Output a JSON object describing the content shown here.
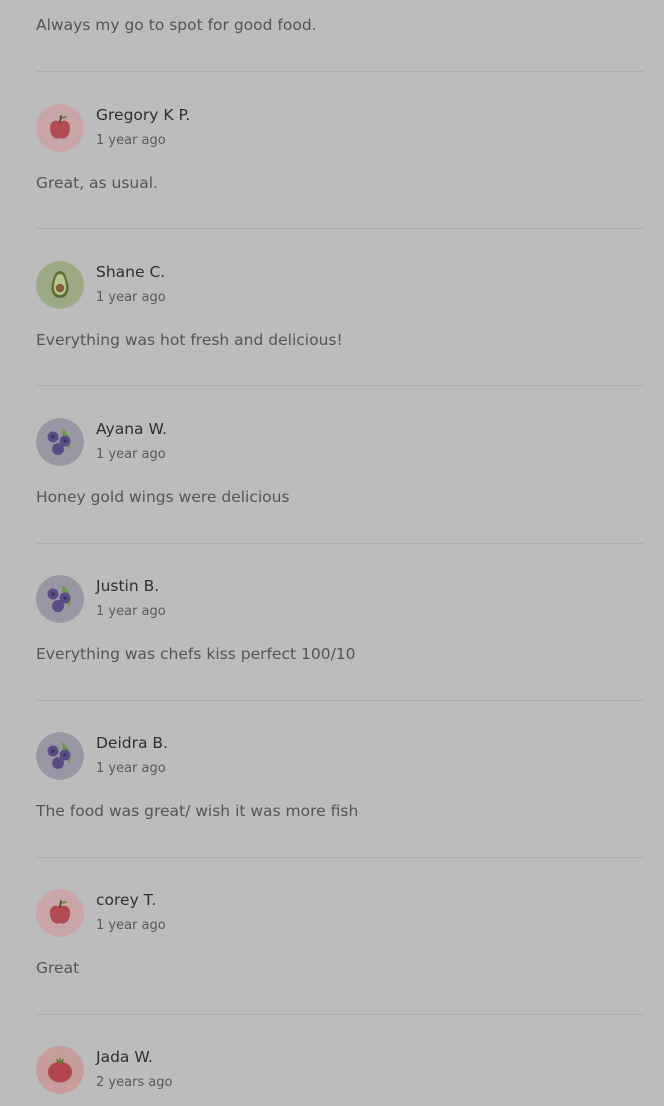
{
  "top_review_text": "Always my go to spot for good food.",
  "reviews": [
    {
      "name": "Gregory K P.",
      "time": "1 year ago",
      "text": "Great, as usual.",
      "avatar": "apple-icon"
    },
    {
      "name": "Shane C.",
      "time": "1 year ago",
      "text": "Everything was hot fresh and delicious!",
      "avatar": "avocado-icon"
    },
    {
      "name": "Ayana W.",
      "time": "1 year ago",
      "text": "Honey gold wings were delicious",
      "avatar": "blueberries-icon"
    },
    {
      "name": "Justin B.",
      "time": "1 year ago",
      "text": "Everything was chefs kiss perfect 100/10",
      "avatar": "blueberries-icon"
    },
    {
      "name": "Deidra B.",
      "time": "1 year ago",
      "text": "The food was great/ wish it was more fish",
      "avatar": "blueberries-icon"
    },
    {
      "name": "corey T.",
      "time": "1 year ago",
      "text": "Great",
      "avatar": "apple-icon"
    },
    {
      "name": "Jada W.",
      "time": "2 years ago",
      "text": "",
      "avatar": "tomato-icon"
    }
  ],
  "colors": {
    "background": "#bcbcbc",
    "divider": "#adadad",
    "apple_bg": "#c9a5a8",
    "avocado_bg": "#9cab86",
    "blueberry_bg": "#9a97a4",
    "tomato_bg": "#c69c9c"
  }
}
